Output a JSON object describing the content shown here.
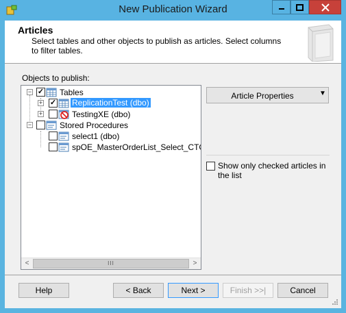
{
  "window": {
    "title": "New Publication Wizard",
    "controls": [
      "minimize-icon",
      "maximize-icon",
      "close-icon"
    ]
  },
  "header": {
    "title": "Articles",
    "description": "Select tables and other objects to publish as articles. Select columns to filter tables."
  },
  "objects_label": "Objects to publish:",
  "tree": [
    {
      "label": "Tables",
      "checked": true,
      "expanded": true,
      "icon": "folder-table-icon",
      "children": [
        {
          "label": "ReplicationTest (dbo)",
          "checked": true,
          "selected": true,
          "icon": "table-icon"
        },
        {
          "label": "TestingXE (dbo)",
          "checked": false,
          "icon": "table-blocked-icon"
        }
      ]
    },
    {
      "label": "Stored Procedures",
      "checked": false,
      "expanded": true,
      "icon": "folder-proc-icon",
      "children": [
        {
          "label": "select1 (dbo)",
          "checked": false,
          "icon": "proc-icon"
        },
        {
          "label": "spOE_MasterOrderList_Select_CTG (db",
          "checked": false,
          "icon": "proc-icon"
        }
      ]
    }
  ],
  "scrollbar_thumb": "III",
  "article_properties": {
    "label": "Article Properties",
    "arrow": "▼"
  },
  "show_checked_label": "Show only checked articles in the list",
  "show_checked_value": false,
  "buttons": {
    "help": "Help",
    "back": "< Back",
    "next": "Next >",
    "finish": "Finish >>|",
    "cancel": "Cancel"
  }
}
